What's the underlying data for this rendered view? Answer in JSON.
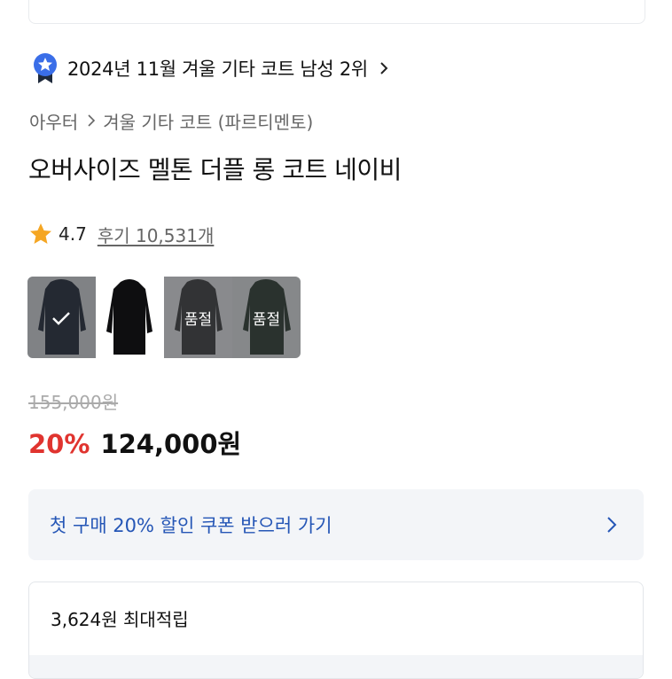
{
  "ranking": {
    "text": "2024년 11월 겨울 기타 코트 남성 2위",
    "medal_icon": "medal-star-icon"
  },
  "breadcrumb": {
    "category": "아우터",
    "subcategory": "겨울 기타 코트 (파르티멘토)"
  },
  "product": {
    "title": "오버사이즈 멜톤 더플 롱 코트 네이비"
  },
  "rating": {
    "score": "4.7",
    "reviews": "후기 10,531개",
    "star_color": "#f5a623"
  },
  "swatches": [
    {
      "name": "color-option-1",
      "selected": true,
      "status": ""
    },
    {
      "name": "color-option-2",
      "selected": false,
      "status": ""
    },
    {
      "name": "color-option-3",
      "selected": false,
      "status": "품절"
    },
    {
      "name": "color-option-4",
      "selected": false,
      "status": "품절"
    }
  ],
  "price": {
    "original": "155,000원",
    "discount": "20%",
    "sale": "124,000원",
    "discount_color": "#e0342f"
  },
  "coupon": {
    "label": "첫 구매 20% 할인 쿠폰 받으러 가기",
    "text_color": "#2556b6"
  },
  "points": {
    "label": "3,624원 최대적립"
  }
}
